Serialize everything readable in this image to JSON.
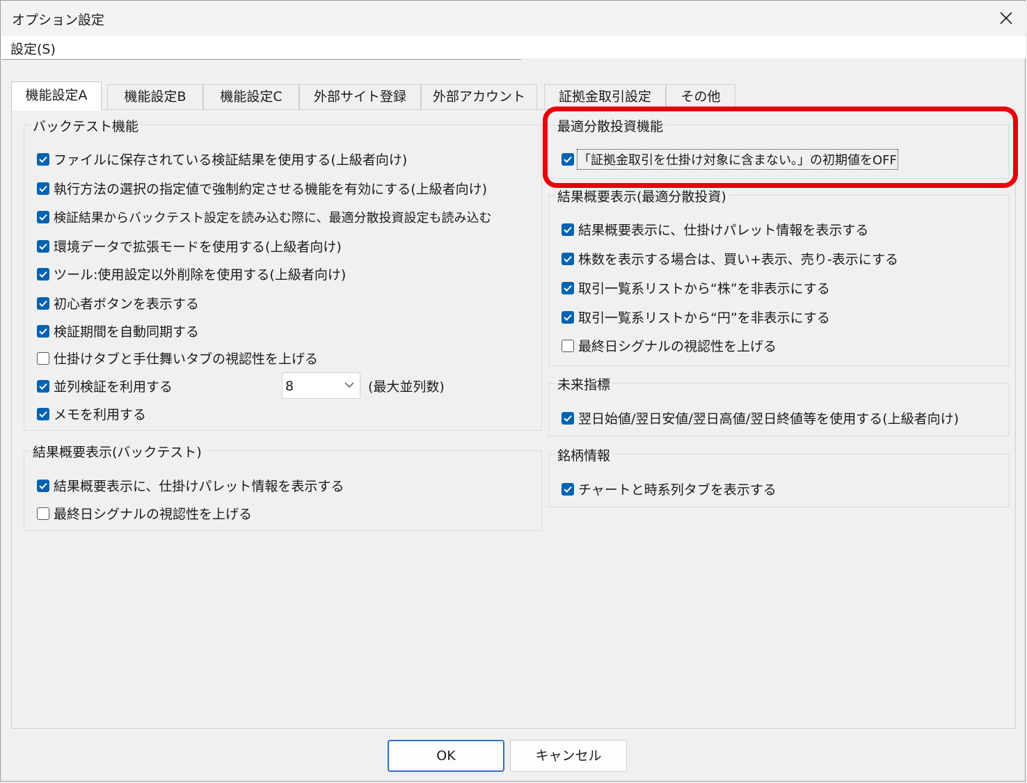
{
  "window": {
    "title": "オプション設定"
  },
  "menu": {
    "settings_label": "設定(S)"
  },
  "tabs": [
    {
      "label": "機能設定A",
      "active": true
    },
    {
      "label": "機能設定B",
      "active": false
    },
    {
      "label": "機能設定C",
      "active": false
    },
    {
      "label": "外部サイト登録",
      "active": false
    },
    {
      "label": "外部アカウント",
      "active": false
    },
    {
      "label": "証拠金取引設定",
      "active": false
    },
    {
      "label": "その他",
      "active": false
    }
  ],
  "backtest": {
    "title": "バックテスト機能",
    "items": [
      {
        "label": "ファイルに保存されている検証結果を使用する(上級者向け)",
        "checked": true
      },
      {
        "label": "執行方法の選択の指定値で強制約定させる機能を有効にする(上級者向け)",
        "checked": true
      },
      {
        "label": "検証結果からバックテスト設定を読み込む際に、最適分散投資設定も読み込む",
        "checked": true
      },
      {
        "label": "環境データで拡張モードを使用する(上級者向け)",
        "checked": true
      },
      {
        "label": "ツール:使用設定以外削除を使用する(上級者向け)",
        "checked": true
      },
      {
        "label": "初心者ボタンを表示する",
        "checked": true
      },
      {
        "label": "検証期間を自動同期する",
        "checked": true
      },
      {
        "label": "仕掛けタブと手仕舞いタブの視認性を上げる",
        "checked": false
      },
      {
        "label": "並列検証を利用する",
        "checked": true
      },
      {
        "label": "メモを利用する",
        "checked": true
      }
    ],
    "parallel_select": {
      "value": "8",
      "suffix": "(最大並列数)"
    }
  },
  "summary_backtest": {
    "title": "結果概要表示(バックテスト)",
    "items": [
      {
        "label": "結果概要表示に、仕掛けパレット情報を表示する",
        "checked": true
      },
      {
        "label": "最終日シグナルの視認性を上げる",
        "checked": false
      }
    ]
  },
  "optimal": {
    "title": "最適分散投資機能",
    "items": [
      {
        "label": "「証拠金取引を仕掛け対象に含まない。」の初期値をOFF",
        "checked": true
      }
    ]
  },
  "summary_optimal": {
    "title": "結果概要表示(最適分散投資)",
    "items": [
      {
        "label": "結果概要表示に、仕掛けパレット情報を表示する",
        "checked": true
      },
      {
        "label": "株数を表示する場合は、買い+表示、売り-表示にする",
        "checked": true
      },
      {
        "label": "取引一覧系リストから“株”を非表示にする",
        "checked": true
      },
      {
        "label": "取引一覧系リストから“円”を非表示にする",
        "checked": true
      },
      {
        "label": "最終日シグナルの視認性を上げる",
        "checked": false
      }
    ]
  },
  "future": {
    "title": "未来指標",
    "items": [
      {
        "label": "翌日始値/翌日安値/翌日高値/翌日終値等を使用する(上級者向け)",
        "checked": true
      }
    ]
  },
  "stock_info": {
    "title": "銘柄情報",
    "items": [
      {
        "label": "チャートと時系列タブを表示する",
        "checked": true
      }
    ]
  },
  "buttons": {
    "ok": "OK",
    "cancel": "キャンセル"
  },
  "colors": {
    "checkbox_accent": "#0063b1",
    "highlight": "#e8000c"
  }
}
